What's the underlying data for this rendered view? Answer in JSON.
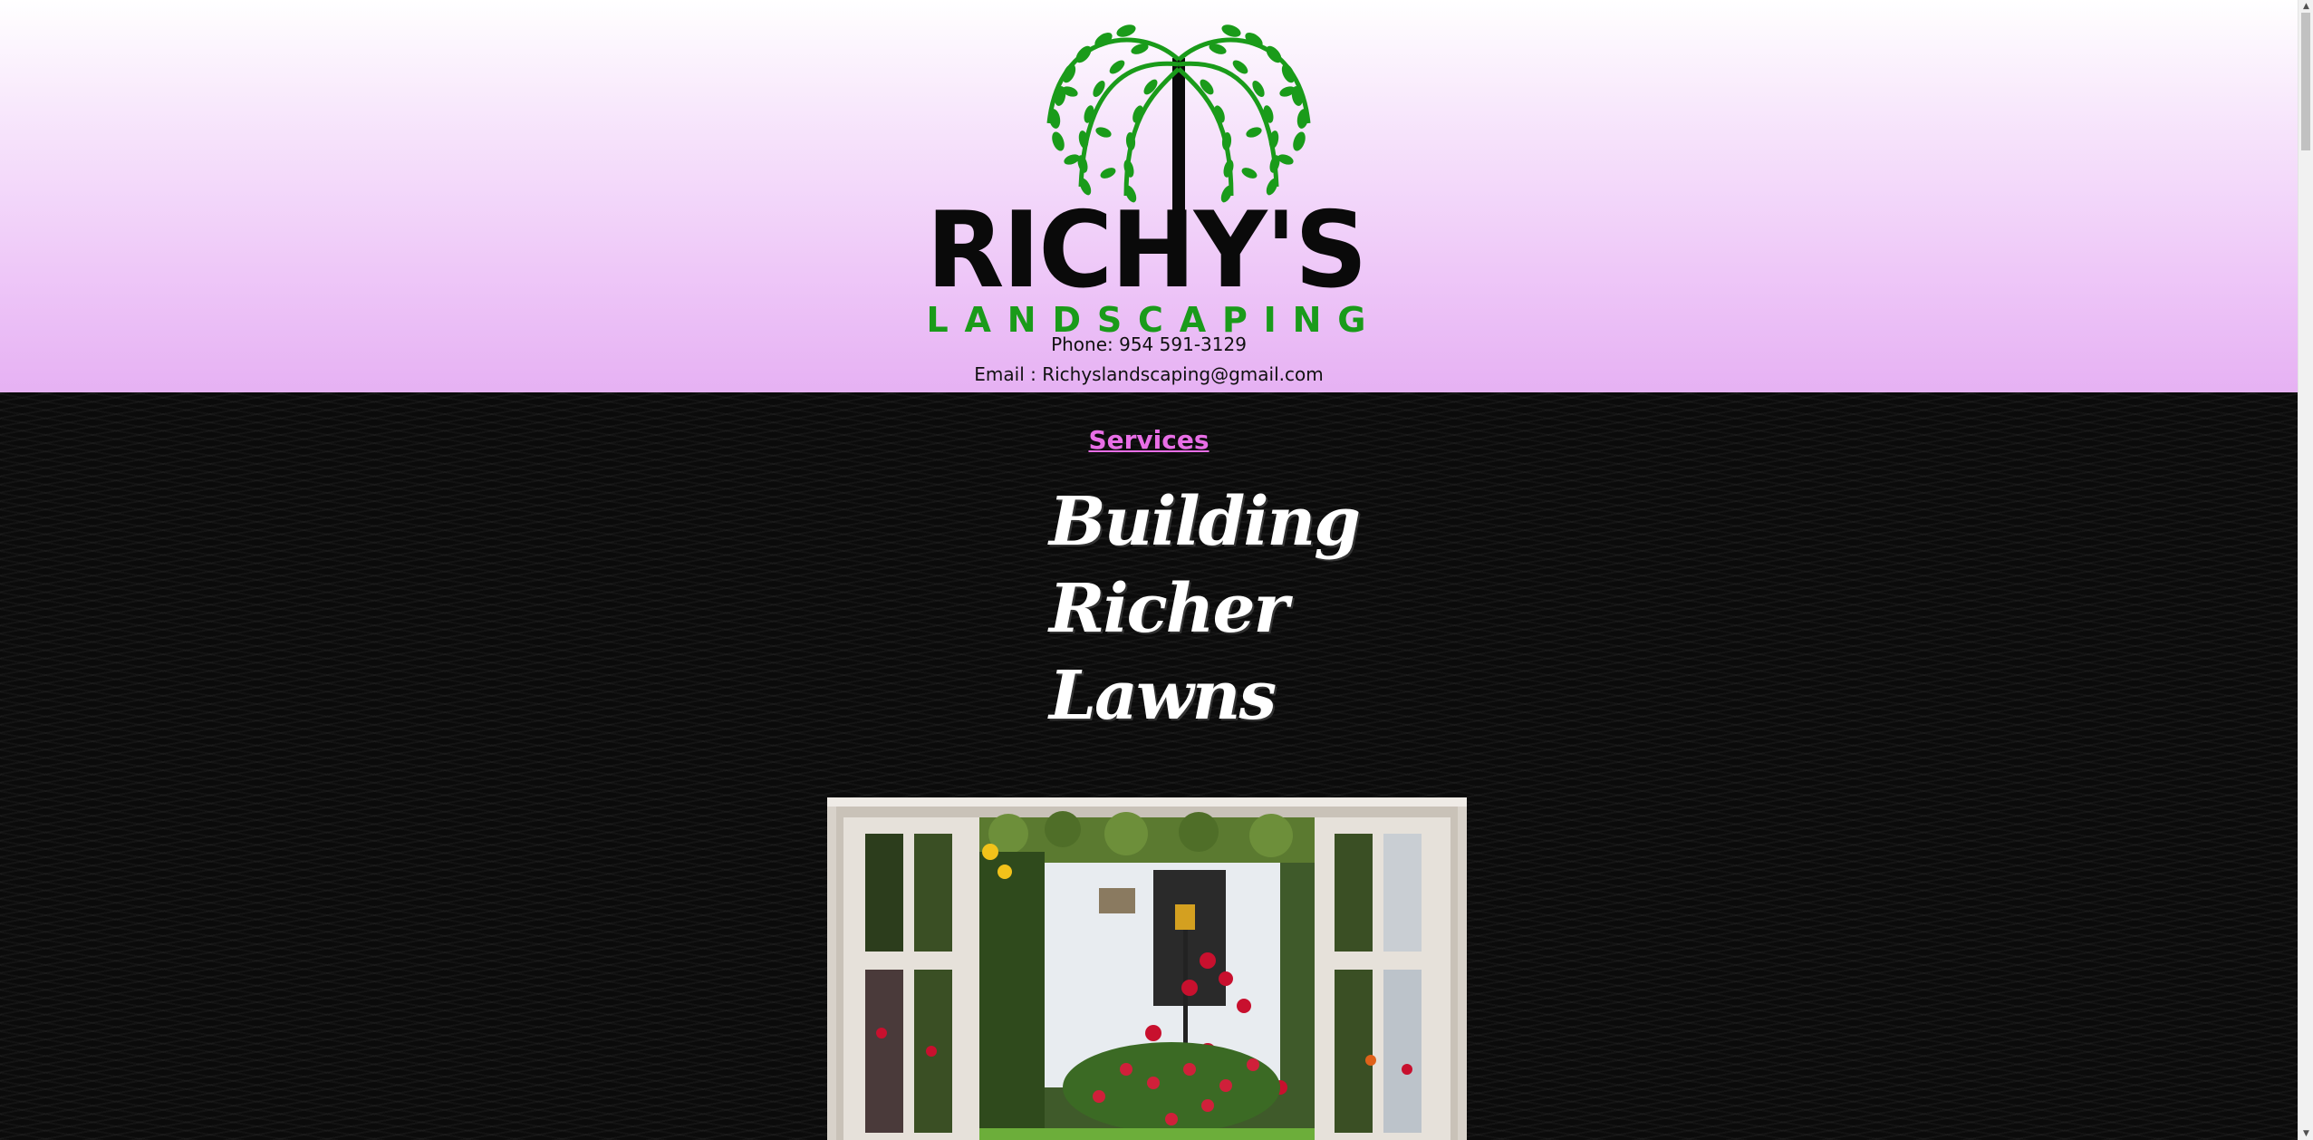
{
  "header": {
    "logo": {
      "name": "RICHY'S",
      "tagline": "LANDSCAPING",
      "icon": "willow-tree-icon"
    },
    "phone": "Phone: 954 591-3129",
    "email": "Email : Richyslandscaping@gmail.com"
  },
  "main": {
    "services_link": "Services",
    "slogan": [
      "Building",
      "Richer",
      "Lawns"
    ],
    "image": {
      "description_icon": "open-window-garden-image"
    }
  },
  "colors": {
    "header_gradient_top": "#ffffff",
    "header_gradient_bottom": "#e6b1f3",
    "background": "#0b0b0b",
    "accent_pink": "#e86ee6",
    "logo_green": "#1a9b1a",
    "logo_black": "#0a0a0a"
  }
}
